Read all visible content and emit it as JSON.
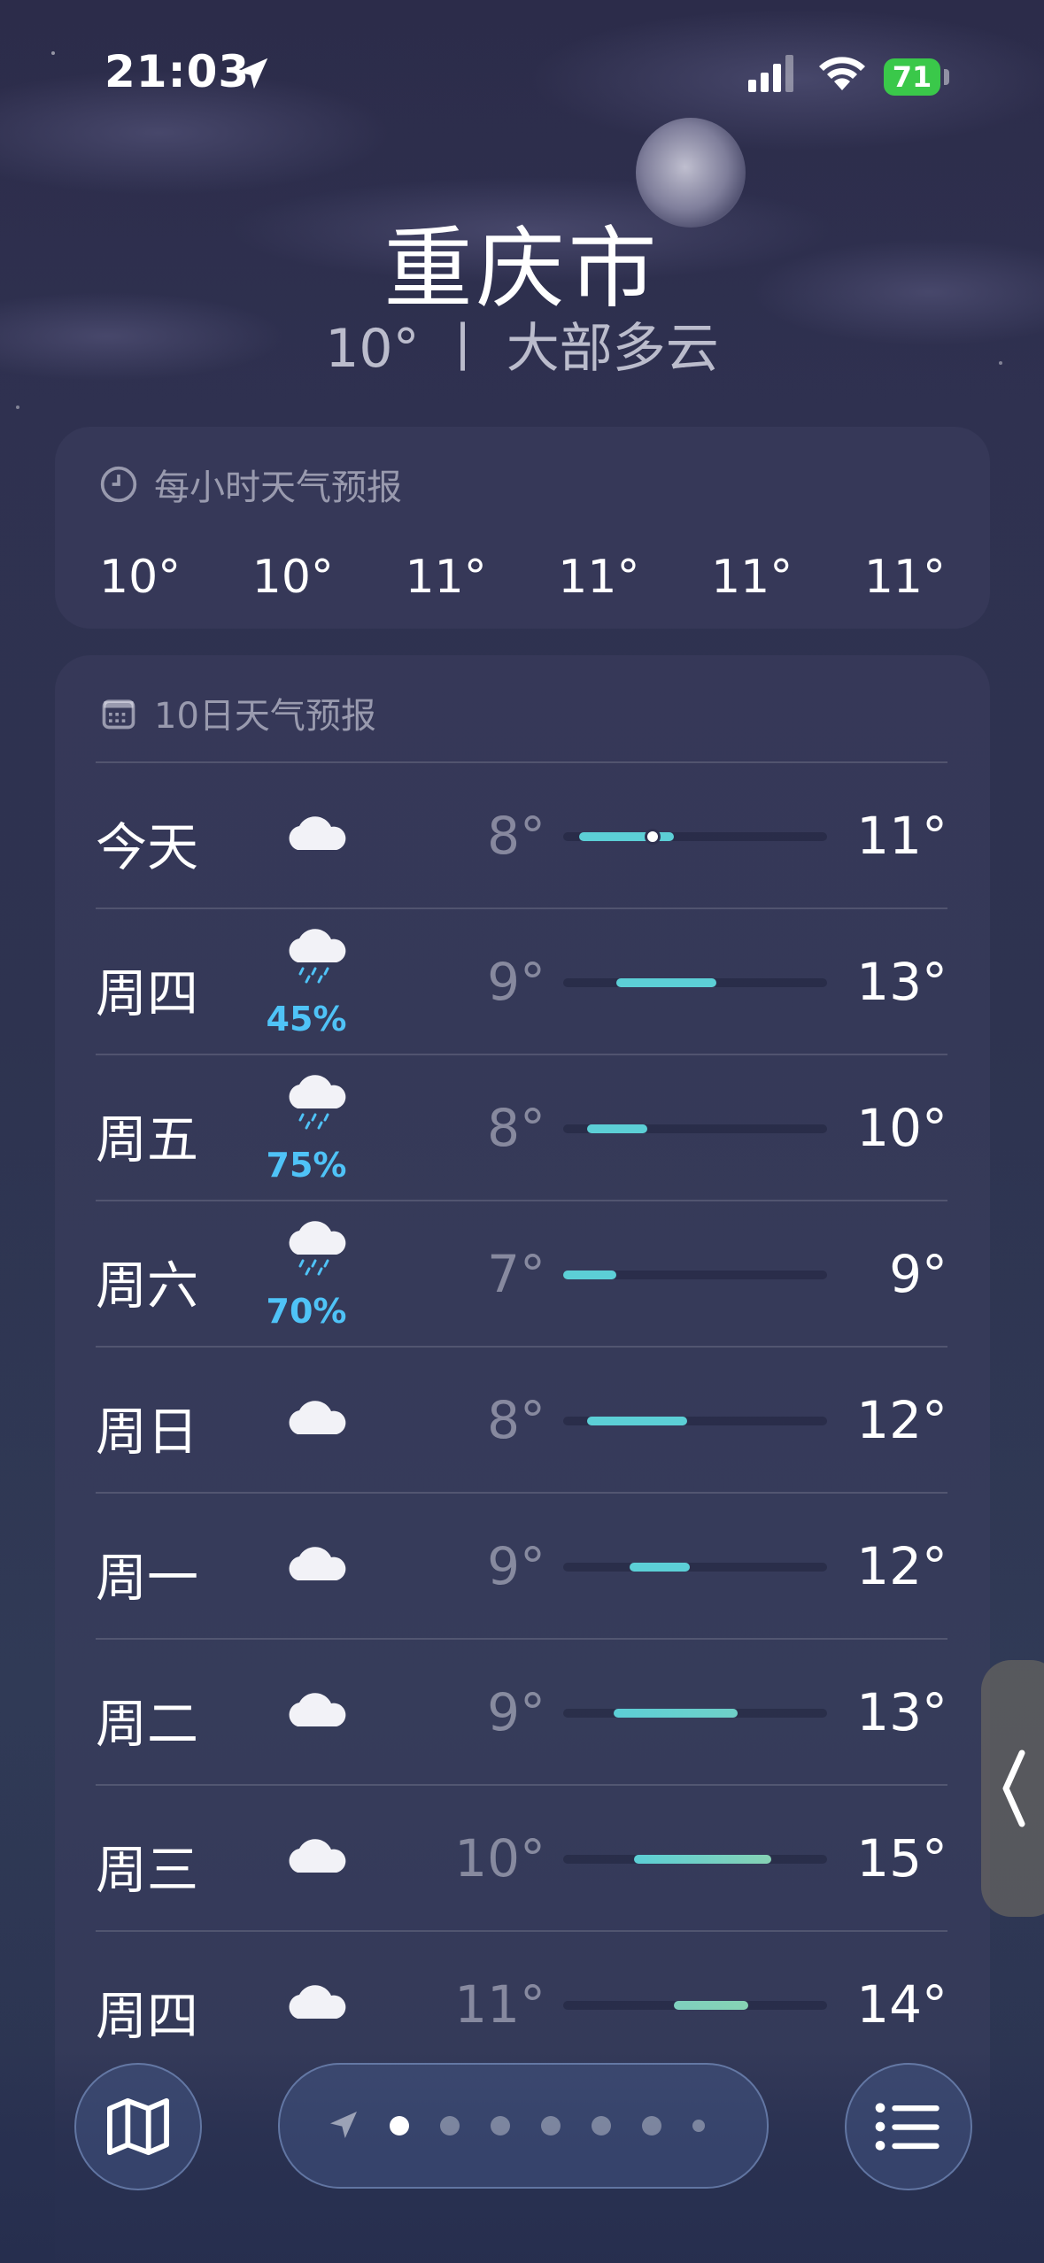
{
  "status": {
    "time": "21:03",
    "battery": "71"
  },
  "city": "重庆市",
  "current": {
    "temp": "10°",
    "separator": "丨",
    "condition": "大部多云"
  },
  "hourly": {
    "title": "每小时天气预报",
    "temps": [
      "10°",
      "10°",
      "11°",
      "11°",
      "11°",
      "11°"
    ]
  },
  "daily": {
    "title": "10日天气预报",
    "days": [
      {
        "day": "今天",
        "icon": "cloud",
        "precip": "",
        "low": "8°",
        "high": "11°",
        "bar_start": 0.06,
        "bar_end": 0.42,
        "current_pos": 0.34,
        "color_from": "#5ccfd6",
        "color_to": "#5ccfd6"
      },
      {
        "day": "周四",
        "icon": "cloud-rain",
        "precip": "45%",
        "low": "9°",
        "high": "13°",
        "bar_start": 0.2,
        "bar_end": 0.58,
        "color_from": "#5ccfd6",
        "color_to": "#5ccfd6"
      },
      {
        "day": "周五",
        "icon": "cloud-rain",
        "precip": "75%",
        "low": "8°",
        "high": "10°",
        "bar_start": 0.09,
        "bar_end": 0.32,
        "color_from": "#5ccfd6",
        "color_to": "#5ccfd6"
      },
      {
        "day": "周六",
        "icon": "cloud-rain",
        "precip": "70%",
        "low": "7°",
        "high": "9°",
        "bar_start": 0.0,
        "bar_end": 0.2,
        "color_from": "#5ccfd6",
        "color_to": "#5ccfd6"
      },
      {
        "day": "周日",
        "icon": "cloud",
        "precip": "",
        "low": "8°",
        "high": "12°",
        "bar_start": 0.09,
        "bar_end": 0.47,
        "color_from": "#5ccfd6",
        "color_to": "#5ccfd6"
      },
      {
        "day": "周一",
        "icon": "cloud",
        "precip": "",
        "low": "9°",
        "high": "12°",
        "bar_start": 0.25,
        "bar_end": 0.48,
        "color_from": "#5ccfd6",
        "color_to": "#5ccfd6"
      },
      {
        "day": "周二",
        "icon": "cloud",
        "precip": "",
        "low": "9°",
        "high": "13°",
        "bar_start": 0.19,
        "bar_end": 0.66,
        "color_from": "#5ccfd6",
        "color_to": "#6fd0c8"
      },
      {
        "day": "周三",
        "icon": "cloud",
        "precip": "",
        "low": "10°",
        "high": "15°",
        "bar_start": 0.27,
        "bar_end": 0.79,
        "color_from": "#5ccfd6",
        "color_to": "#86d2b4"
      },
      {
        "day": "周四",
        "icon": "cloud",
        "precip": "",
        "low": "11°",
        "high": "14°",
        "bar_start": 0.42,
        "bar_end": 0.7,
        "color_from": "#7fd0be",
        "color_to": "#86d2b4"
      }
    ]
  },
  "pager": {
    "count": 7,
    "active": 0
  },
  "colors": {
    "accent_precip": "#4fc3f7",
    "bar_teal": "#5ccfd6"
  }
}
